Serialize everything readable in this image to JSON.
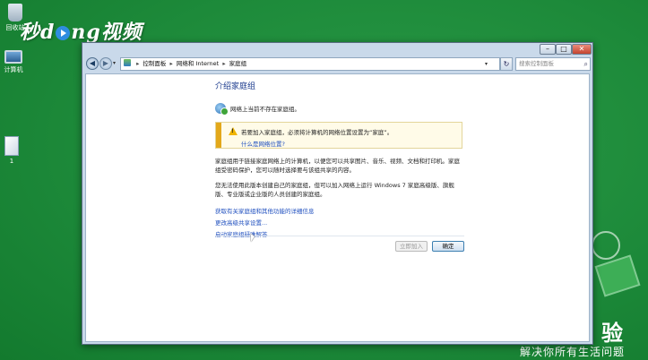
{
  "watermark": {
    "logo_part1": "秒d",
    "logo_part2": "ng视频",
    "bottom_right_char": "验",
    "slogan": "解决你所有生活问题"
  },
  "desktop": {
    "icons": [
      {
        "label": "回收站",
        "icon": "recycle-bin-icon"
      },
      {
        "label": "计算机",
        "icon": "computer-icon"
      },
      {
        "label": "1",
        "icon": "file-icon"
      }
    ]
  },
  "window": {
    "title_buttons": {
      "minimize": "–",
      "maximize": "□",
      "close": "✕"
    },
    "nav": {
      "back": "◀",
      "forward": "▶",
      "dropdown": "▾"
    },
    "address": {
      "breadcrumb": [
        "控制面板",
        "网络和 Internet",
        "家庭组"
      ],
      "separator": "▸",
      "dropdown": "▾"
    },
    "refresh_glyph": "↻",
    "search": {
      "placeholder": "搜索控制面板",
      "glyph": "⌕"
    },
    "content": {
      "title": "介绍家庭组",
      "status": "网络上当前不存在家庭组。",
      "warning": {
        "icon_mark": "!",
        "text": "若要加入家庭组，必须将计算机的网络位置设置为“家庭”。",
        "link": "什么是网络位置?"
      },
      "paragraph1": "家庭组用于链接家庭网络上的计算机，以便您可以共享图片、音乐、视频、文档和打印机。家庭组受密码保护，您可以随时选择要与该组共享的内容。",
      "paragraph2": "您无法使用此版本创建自己的家庭组，但可以加入网络上运行 Windows 7 家庭高级版、旗舰版、专业版或企业版的人员创建的家庭组。",
      "links": [
        "获取有关家庭组和其他功能的详细信息",
        "更改高级共享设置...",
        "启动家庭组疑难解答"
      ],
      "buttons": {
        "join": "立即加入",
        "ok": "确定"
      }
    }
  }
}
